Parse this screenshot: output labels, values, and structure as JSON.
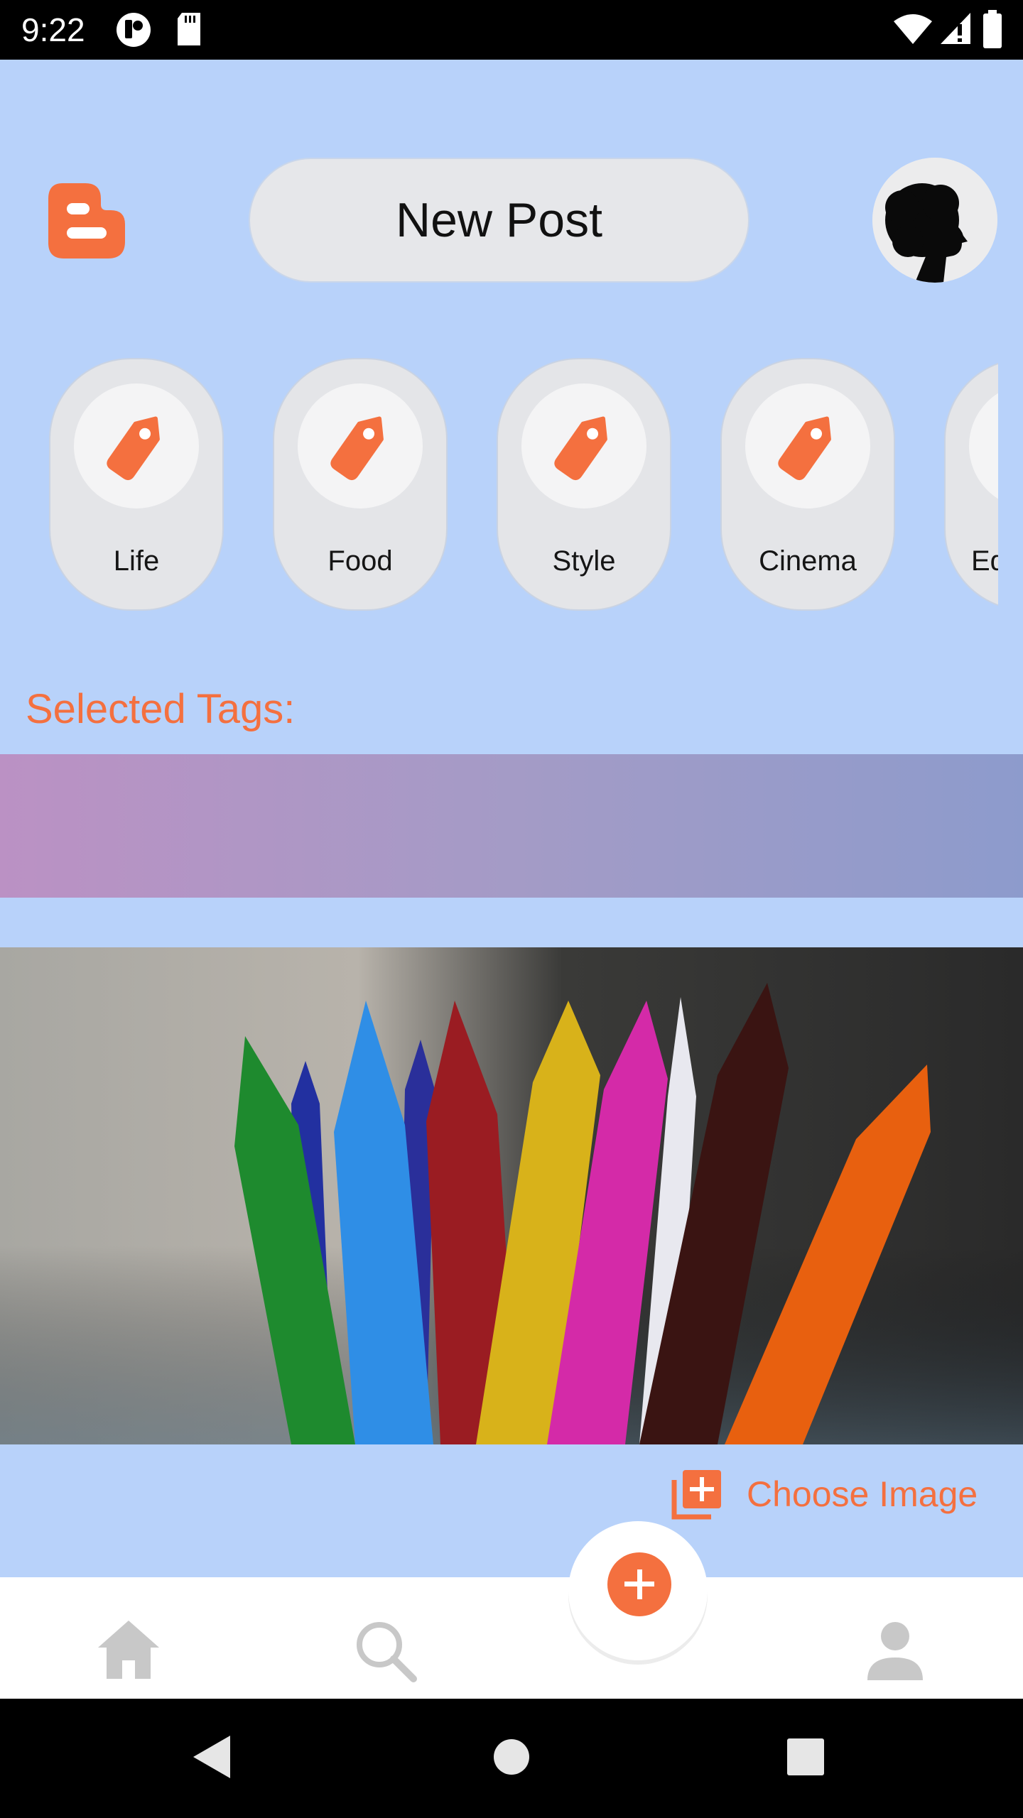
{
  "status_bar": {
    "time": "9:22"
  },
  "header": {
    "new_post_label": "New Post"
  },
  "tags": [
    {
      "label": "Life"
    },
    {
      "label": "Food"
    },
    {
      "label": "Style"
    },
    {
      "label": "Cinema"
    },
    {
      "label": "Ed"
    }
  ],
  "selected_tags": {
    "label": "Selected Tags:"
  },
  "image_section": {
    "choose_image_label": "Choose Image"
  },
  "bottom_nav": {
    "items": [
      "home-icon",
      "search-icon",
      "add-icon",
      "profile-icon"
    ]
  },
  "colors": {
    "accent": "#f4703f",
    "background": "#b8d2fa",
    "pill": "#e6e7ea",
    "nav_icon": "#c8c8c8"
  }
}
